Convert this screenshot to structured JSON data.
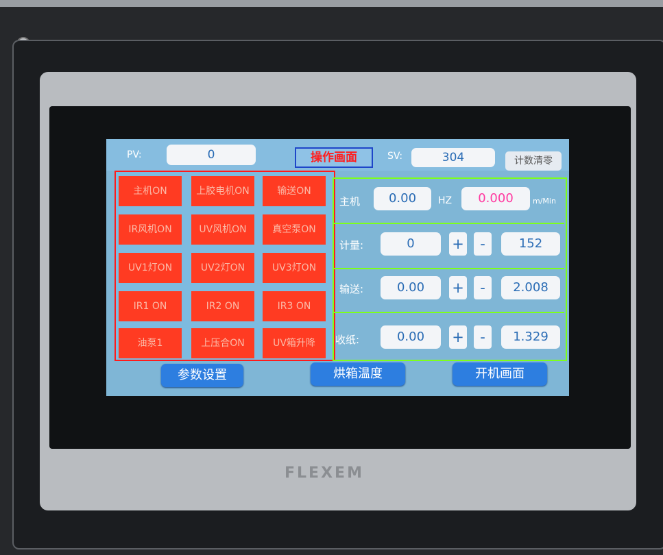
{
  "device": {
    "brand_logo": "FLEXEM"
  },
  "header": {
    "pv_label": "PV:",
    "pv_value": "0",
    "title": "操作画面",
    "sv_label": "SV:",
    "sv_value": "304",
    "reset_label": "计数清零"
  },
  "left_grid": [
    {
      "label": "主机ON"
    },
    {
      "label": "上胶电机ON"
    },
    {
      "label": "输送ON"
    },
    {
      "label": "IR风机ON"
    },
    {
      "label": "UV风机ON"
    },
    {
      "label": "真空泵ON"
    },
    {
      "label": "UV1灯ON"
    },
    {
      "label": "UV2灯ON"
    },
    {
      "label": "UV3灯ON"
    },
    {
      "label": "IR1 ON"
    },
    {
      "label": "IR2 ON"
    },
    {
      "label": "IR3 ON"
    },
    {
      "label": "油泵1"
    },
    {
      "label": "上压合ON"
    },
    {
      "label": "UV箱升降"
    }
  ],
  "right_rows": {
    "main": {
      "label": "主机",
      "value": "0.00",
      "unit": "HZ",
      "speed": "0.000",
      "speed_unit": "m/Min"
    },
    "metering": {
      "label": "计量:",
      "value": "0",
      "plus": "+",
      "minus": "-",
      "setpoint": "152"
    },
    "conveyor": {
      "label": "输送:",
      "value": "0.00",
      "plus": "+",
      "minus": "-",
      "setpoint": "2.008"
    },
    "paper": {
      "label": "收纸:",
      "value": "0.00",
      "plus": "+",
      "minus": "-",
      "setpoint": "1.329"
    }
  },
  "bottom_nav": {
    "params": "参数设置",
    "oven": "烘箱温度",
    "startup": "开机画面"
  },
  "colors": {
    "button_red": "#ff3b22",
    "grid_border": "#ff1b1b",
    "panel_border": "#7dff1b",
    "screen_bg": "#7fb6d6",
    "accent_blue": "#2d7ee0"
  }
}
